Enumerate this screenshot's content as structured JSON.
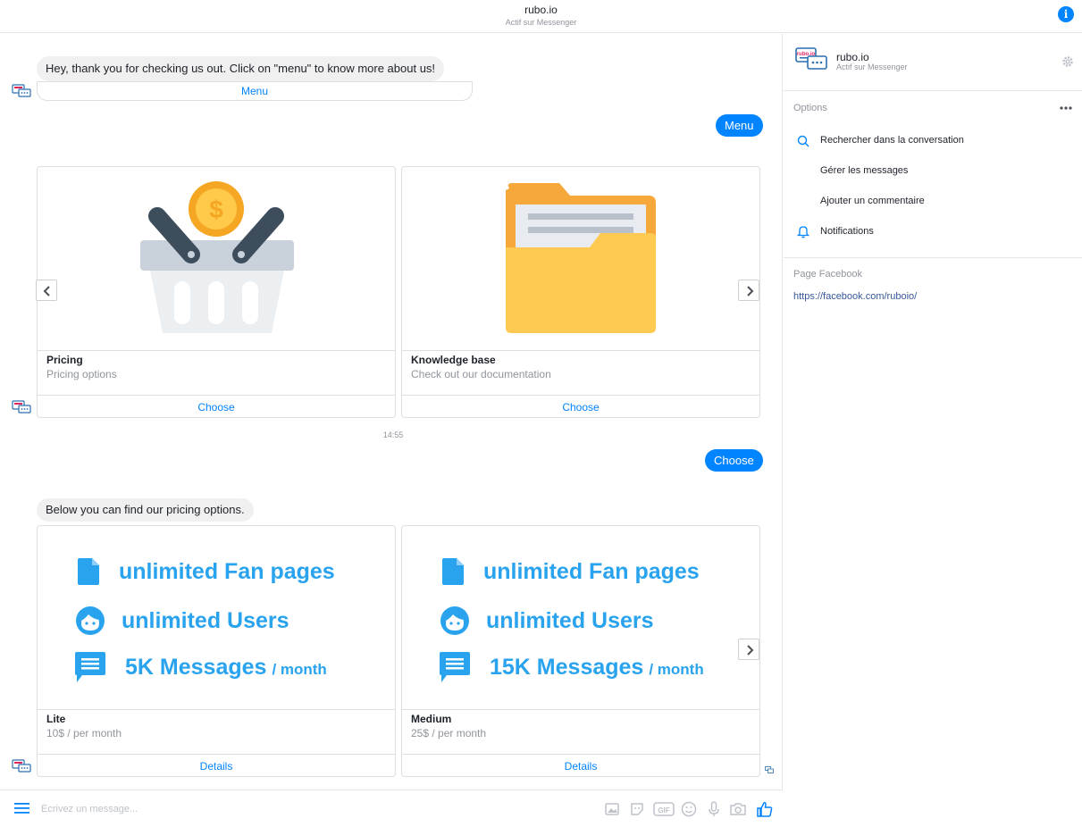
{
  "header": {
    "title": "rubo.io",
    "subtitle": "Actif sur Messenger"
  },
  "messages": {
    "greeting": "Hey, thank you for checking us out. Click on \"menu\" to know more about us!",
    "menu_button": "Menu",
    "user_menu": "Menu",
    "timestamp": "14:55",
    "user_choose": "Choose",
    "pricing_intro": "Below you can find our pricing options."
  },
  "carousel1": [
    {
      "title": "Pricing",
      "subtitle": "Pricing options",
      "button": "Choose",
      "icon": "basket-coin-icon"
    },
    {
      "title": "Knowledge base",
      "subtitle": "Check out our documentation",
      "button": "Choose",
      "icon": "folder-icon"
    }
  ],
  "carousel2": [
    {
      "title": "Lite",
      "subtitle": "10$ / per month",
      "button": "Details",
      "features": {
        "fan_pages": "unlimited Fan pages",
        "users": "unlimited Users",
        "messages": "5K Messages",
        "per": "/ month"
      }
    },
    {
      "title": "Medium",
      "subtitle": "25$ / per month",
      "button": "Details",
      "features": {
        "fan_pages": "unlimited Fan pages",
        "users": "unlimited Users",
        "messages": "15K Messages",
        "per": "/ month"
      }
    }
  ],
  "composer": {
    "placeholder": "Écrivez un message..."
  },
  "sidebar": {
    "brand": "rubo.io",
    "brand_status": "Actif sur Messenger",
    "options_title": "Options",
    "options": [
      {
        "label": "Rechercher dans la conversation",
        "icon": "search-icon"
      },
      {
        "label": "Gérer les messages",
        "icon": ""
      },
      {
        "label": "Ajouter un commentaire",
        "icon": ""
      },
      {
        "label": "Notifications",
        "icon": "bell-icon"
      }
    ],
    "page_title": "Page Facebook",
    "page_link": "https://facebook.com/ruboio/"
  },
  "colors": {
    "accent": "#0084ff",
    "feature_blue": "#29a3ee",
    "bubble_grey": "#f1f0f0"
  }
}
